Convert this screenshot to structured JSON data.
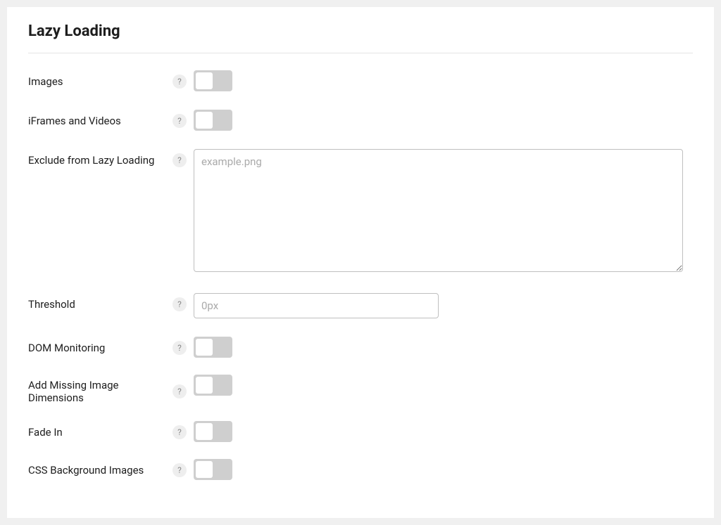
{
  "section": {
    "title": "Lazy Loading"
  },
  "rows": {
    "images": {
      "label": "Images",
      "on": false
    },
    "iframes": {
      "label": "iFrames and Videos",
      "on": false
    },
    "exclude": {
      "label": "Exclude from Lazy Loading",
      "placeholder": "example.png",
      "value": ""
    },
    "threshold": {
      "label": "Threshold",
      "placeholder": "0px",
      "value": ""
    },
    "dom": {
      "label": "DOM Monitoring",
      "on": false
    },
    "dimensions": {
      "label": "Add Missing Image Dimensions",
      "on": false
    },
    "fade": {
      "label": "Fade In",
      "on": false
    },
    "cssbg": {
      "label": "CSS Background Images",
      "on": false
    }
  },
  "help_glyph": "?"
}
